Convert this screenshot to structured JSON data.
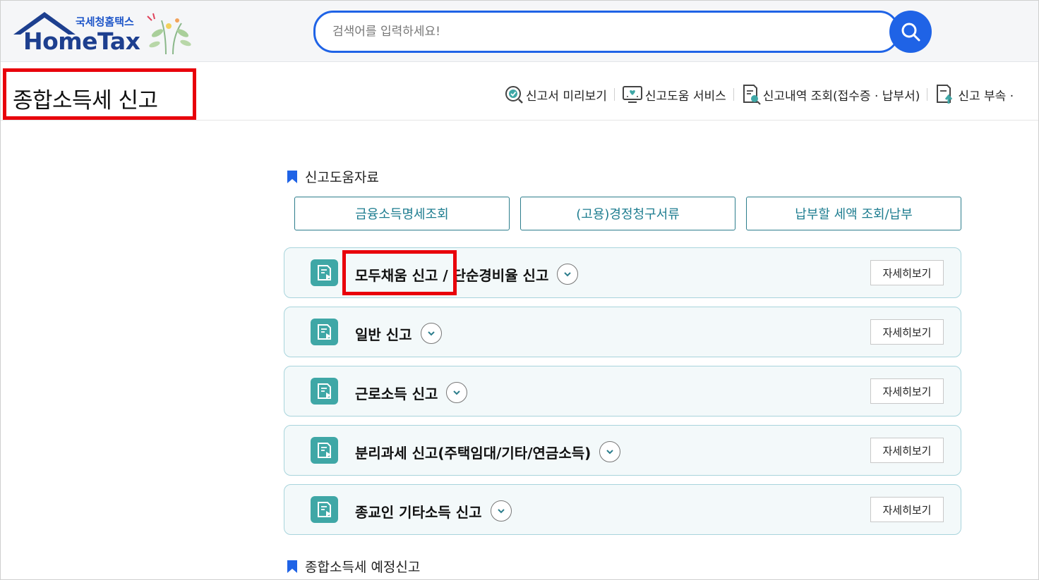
{
  "header": {
    "logo_kr": "국세청홈택스",
    "logo_en": "HomeTax",
    "search_placeholder": "검색어를 입력하세요!"
  },
  "page": {
    "title": "종합소득세 신고"
  },
  "util_links": [
    {
      "label": "신고서 미리보기",
      "icon": "magnifier-check-icon"
    },
    {
      "label": "신고도움 서비스",
      "icon": "monitor-heart-icon"
    },
    {
      "label": "신고내역 조회(접수증 · 납부서)",
      "icon": "document-search-icon"
    },
    {
      "label": "신고 부속 ·",
      "icon": "document-upload-icon"
    }
  ],
  "help_section": {
    "heading": "신고도움자료",
    "buttons": [
      "금융소득명세조회",
      "(고용)경정청구서류",
      "납부할 세액 조회/납부"
    ]
  },
  "filing_items": [
    {
      "label": "모두채움 신고 / 단순경비율 신고",
      "detail": "자세히보기"
    },
    {
      "label": "일반 신고",
      "detail": "자세히보기"
    },
    {
      "label": "근로소득 신고",
      "detail": "자세히보기"
    },
    {
      "label": "분리과세 신고(주택임대/기타/연금소득)",
      "detail": "자세히보기"
    },
    {
      "label": "종교인 기타소득 신고",
      "detail": "자세히보기"
    }
  ],
  "estimate_section": {
    "heading": "종합소득세 예정신고"
  },
  "colors": {
    "primary_blue": "#1f63e6",
    "teal": "#3fa7a6",
    "highlight_red": "#e8000b"
  }
}
